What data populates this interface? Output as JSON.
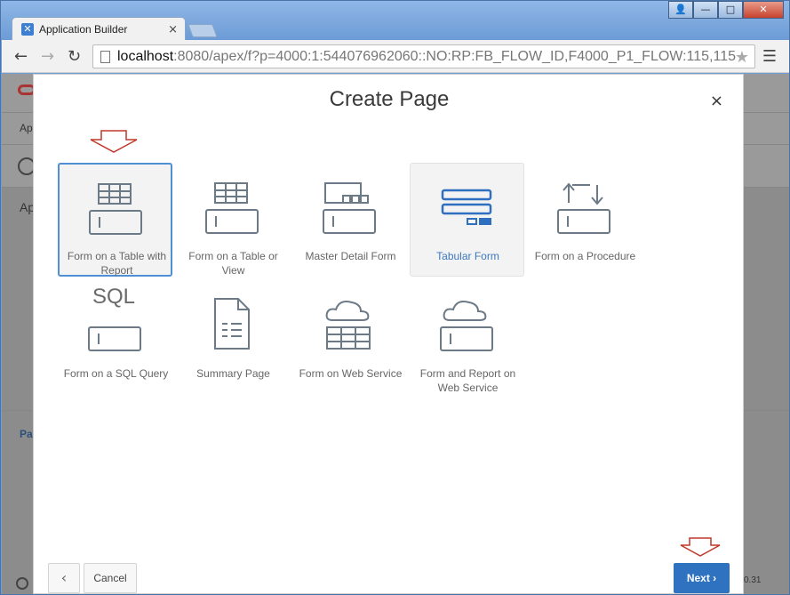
{
  "browser": {
    "tab_title": "Application Builder",
    "tab_close": "×",
    "url_host": "localhost",
    "url_rest": ":8080/apex/f?p=4000:1:544076962060::NO:RP:FB_FLOW_ID,F4000_P1_FLOW:115,115",
    "back_glyph": "←",
    "forward_glyph": "→",
    "reload_glyph": "↻",
    "star_glyph": "★",
    "menu_glyph": "☰",
    "win_min": "—",
    "win_max": "□",
    "win_close": "✕",
    "win_user": "👤"
  },
  "background": {
    "item_ap1": "Ap",
    "item_ap2": "Ap",
    "item_pa": "Pa",
    "item_version": "0.31"
  },
  "modal": {
    "title": "Create Page",
    "close_glyph": "×",
    "cards": [
      {
        "label": "Form on a Table with Report",
        "icon": "form-table-icon"
      },
      {
        "label": "Form on a Table or View",
        "icon": "form-table-icon"
      },
      {
        "label": "Master Detail Form",
        "icon": "master-detail-icon"
      },
      {
        "label": "Tabular Form",
        "icon": "tabular-form-icon"
      },
      {
        "label": "Form on a Procedure",
        "icon": "procedure-icon"
      },
      {
        "label": "Form on a SQL Query",
        "icon": "sql-query-icon",
        "icon_text": "SQL"
      },
      {
        "label": "Summary Page",
        "icon": "summary-page-icon"
      },
      {
        "label": "Form on Web Service",
        "icon": "web-service-icon"
      },
      {
        "label": "Form and Report on Web Service",
        "icon": "web-service-form-icon"
      }
    ],
    "footer": {
      "back_glyph": "‹",
      "cancel_label": "Cancel",
      "next_label": "Next",
      "next_glyph": "›"
    }
  },
  "colors": {
    "accent": "#2f72c0",
    "selected_border": "#4f8fd3",
    "annotation_arrow": "#c0392b"
  }
}
